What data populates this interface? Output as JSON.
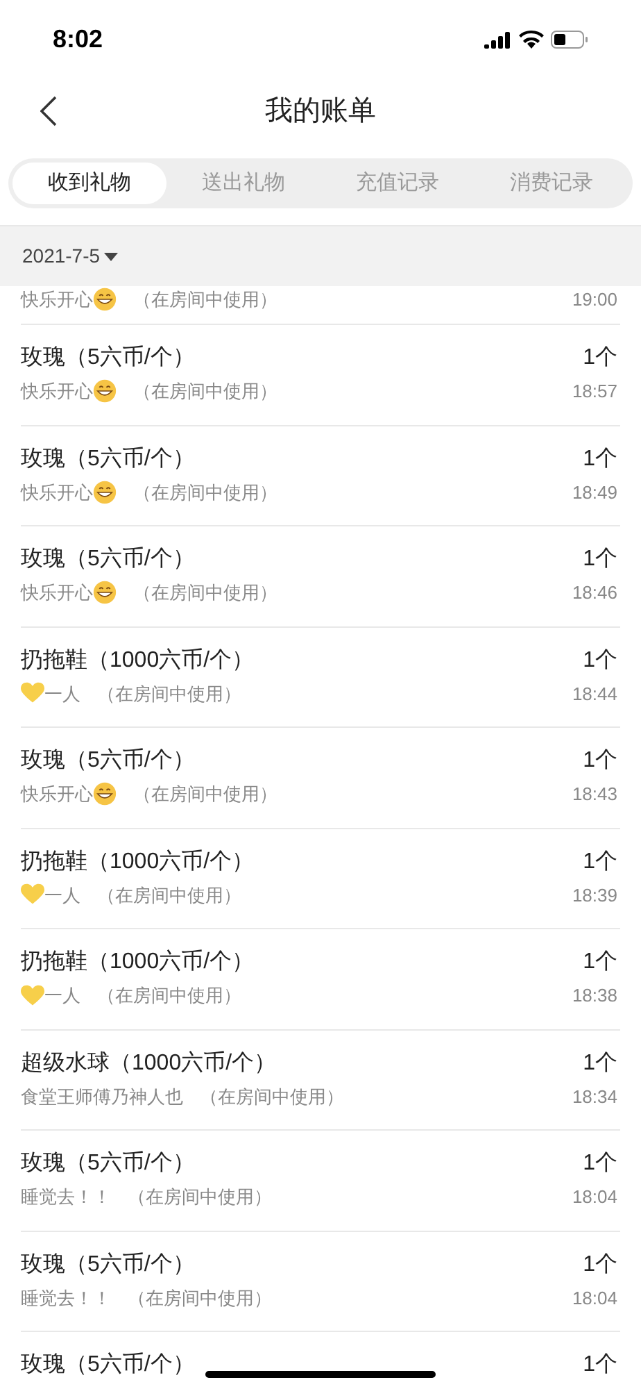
{
  "status_bar": {
    "time": "8:02"
  },
  "header": {
    "title": "我的账单"
  },
  "tabs": [
    {
      "label": "收到礼物",
      "selected": true
    },
    {
      "label": "送出礼物",
      "selected": false
    },
    {
      "label": "充值记录",
      "selected": false
    },
    {
      "label": "消费记录",
      "selected": false
    }
  ],
  "date_header": {
    "label": "2021-7-5"
  },
  "rows": [
    {
      "sender": [
        {
          "kind": "text",
          "text": "快乐开心"
        },
        {
          "kind": "grin"
        }
      ],
      "note": "（在房间中使用）",
      "time": "19:00"
    },
    {
      "title": "玫瑰（5六币/个）",
      "sender": [
        {
          "kind": "text",
          "text": "快乐开心"
        },
        {
          "kind": "grin"
        }
      ],
      "note": "（在房间中使用）",
      "qty": "1个",
      "time": "18:57"
    },
    {
      "title": "玫瑰（5六币/个）",
      "sender": [
        {
          "kind": "text",
          "text": "快乐开心"
        },
        {
          "kind": "grin"
        }
      ],
      "note": "（在房间中使用）",
      "qty": "1个",
      "time": "18:49"
    },
    {
      "title": "玫瑰（5六币/个）",
      "sender": [
        {
          "kind": "text",
          "text": "快乐开心"
        },
        {
          "kind": "grin"
        }
      ],
      "note": "（在房间中使用）",
      "qty": "1个",
      "time": "18:46"
    },
    {
      "title": "扔拖鞋（1000六币/个）",
      "sender": [
        {
          "kind": "heart"
        },
        {
          "kind": "text",
          "text": "一人"
        }
      ],
      "note": "（在房间中使用）",
      "qty": "1个",
      "time": "18:44"
    },
    {
      "title": "玫瑰（5六币/个）",
      "sender": [
        {
          "kind": "text",
          "text": "快乐开心"
        },
        {
          "kind": "grin"
        }
      ],
      "note": "（在房间中使用）",
      "qty": "1个",
      "time": "18:43"
    },
    {
      "title": "扔拖鞋（1000六币/个）",
      "sender": [
        {
          "kind": "heart"
        },
        {
          "kind": "text",
          "text": "一人"
        }
      ],
      "note": "（在房间中使用）",
      "qty": "1个",
      "time": "18:39"
    },
    {
      "title": "扔拖鞋（1000六币/个）",
      "sender": [
        {
          "kind": "heart"
        },
        {
          "kind": "text",
          "text": "一人"
        }
      ],
      "note": "（在房间中使用）",
      "qty": "1个",
      "time": "18:38"
    },
    {
      "title": "超级水球（1000六币/个）",
      "sender": [
        {
          "kind": "text",
          "text": "食堂王师傅乃神人也"
        }
      ],
      "note": "（在房间中使用）",
      "qty": "1个",
      "time": "18:34"
    },
    {
      "title": "玫瑰（5六币/个）",
      "sender": [
        {
          "kind": "text",
          "text": "睡觉去！！"
        }
      ],
      "note": "（在房间中使用）",
      "qty": "1个",
      "time": "18:04"
    },
    {
      "title": "玫瑰（5六币/个）",
      "sender": [
        {
          "kind": "text",
          "text": "睡觉去！！"
        }
      ],
      "note": "（在房间中使用）",
      "qty": "1个",
      "time": "18:04"
    },
    {
      "title": "玫瑰（5六币/个）",
      "qty": "1个"
    }
  ]
}
